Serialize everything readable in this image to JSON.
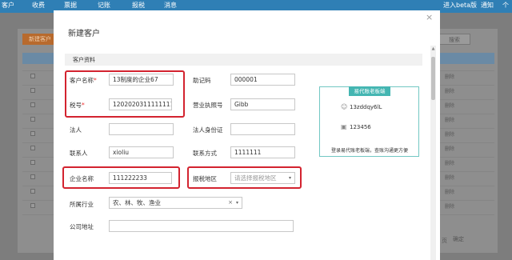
{
  "topbar": {
    "nav": [
      "客户",
      "收费",
      "票据",
      "记账",
      "报税",
      "消息"
    ],
    "right": [
      "进入beta版",
      "通知",
      "个"
    ]
  },
  "background": {
    "add_button": "新建客户",
    "search_button": "搜索",
    "row_action": "删除",
    "footer_left": "页",
    "footer_right": "确定"
  },
  "modal": {
    "title": "新建客户",
    "close": "×",
    "section": "客户资料",
    "fields": {
      "customer_name": {
        "label": "客户名称",
        "required": "*",
        "value": "13制度的企业67"
      },
      "tax_no": {
        "label": "税号",
        "required": "*",
        "value": "120202031111111111"
      },
      "legal_person": {
        "label": "法人",
        "value": ""
      },
      "contact": {
        "label": "联系人",
        "value": "xioliu"
      },
      "company_name": {
        "label": "企业名称",
        "value": "111222233"
      },
      "industry": {
        "label": "所属行业",
        "value": "农、林、牧、渔业",
        "clear": "×",
        "caret": "▾"
      },
      "address": {
        "label": "公司地址",
        "value": ""
      },
      "mnemonic": {
        "label": "助记码",
        "value": "000001"
      },
      "license_no": {
        "label": "营业执照号",
        "value": "Gibb"
      },
      "legal_id": {
        "label": "法人身份证",
        "value": ""
      },
      "contact_phone": {
        "label": "联系方式",
        "value": "1111111"
      },
      "tax_region": {
        "label": "报税地区",
        "placeholder": "请选择报税地区",
        "caret": "▾"
      }
    },
    "card": {
      "title": "易代账老板端",
      "username": "13zddqy6lL",
      "password": "123456",
      "footer": "登录易代账老板端，查账沟通更方便"
    }
  },
  "colors": {
    "highlight": "#d3232f",
    "card_accent": "#44b6b2",
    "topbar": "#2f7fb5"
  }
}
